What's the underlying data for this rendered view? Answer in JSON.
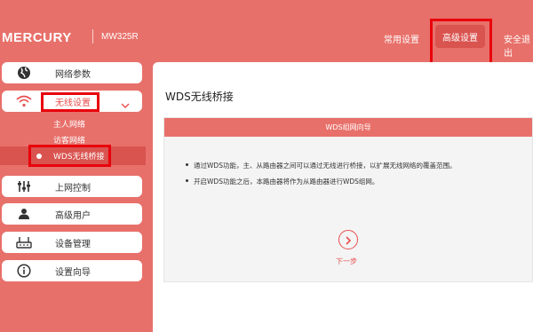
{
  "header": {
    "brand": "MERCURY",
    "model": "MW325R",
    "nav": {
      "basic": "常用设置",
      "advanced": "高级设置",
      "safe_exit": "安全退出"
    }
  },
  "sidebar": {
    "items": [
      {
        "label": "网络参数",
        "icon": "globe-icon"
      },
      {
        "label": "无线设置",
        "icon": "wifi-icon"
      },
      {
        "label": "上网控制",
        "icon": "sliders-icon"
      },
      {
        "label": "高级用户",
        "icon": "user-icon"
      },
      {
        "label": "设备管理",
        "icon": "router-icon"
      },
      {
        "label": "设置向导",
        "icon": "info-icon"
      }
    ],
    "wireless_sub": [
      {
        "label": "主人网络"
      },
      {
        "label": "访客网络"
      },
      {
        "label": "WDS无线桥接"
      }
    ]
  },
  "main": {
    "title": "WDS无线桥接",
    "wizard_title": "WDS组网向导",
    "bullets": [
      "通过WDS功能，主、从路由器之间可以通过无线进行桥接，以扩展无线网络的覆盖范围。",
      "开启WDS功能之后，本路由器将作为从路由器进行WDS组网。"
    ],
    "next_label": "下一步"
  },
  "colors": {
    "brand_bg": "#e8706a",
    "accent": "#e84e4f",
    "active_bg": "#d9534f",
    "highlight_box": "#e8000b"
  }
}
